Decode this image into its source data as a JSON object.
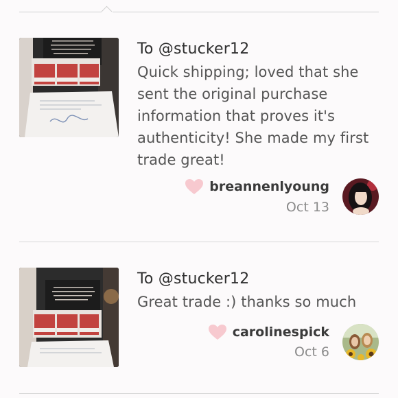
{
  "reviews": [
    {
      "recipient": "To @stucker12",
      "comment": "Quick shipping; loved that she sent the original purchase information that proves it's authenticity! She made my first trade great!",
      "username": "breannenlyoung",
      "date": "Oct 13",
      "photo_icon": "product-photo",
      "avatar_icon": "user-avatar",
      "like_icon": "heart-icon"
    },
    {
      "recipient": "To @stucker12",
      "comment": "Great trade :) thanks so much",
      "username": "carolinespick",
      "date": "Oct 6",
      "photo_icon": "product-photo",
      "avatar_icon": "user-avatar",
      "like_icon": "heart-icon"
    }
  ],
  "colors": {
    "background": "#fcfafb",
    "heart": "#f7c9cf",
    "divider": "#d8d8d8",
    "text_primary": "#2f2f2f",
    "text_secondary": "#8a8a8a"
  }
}
